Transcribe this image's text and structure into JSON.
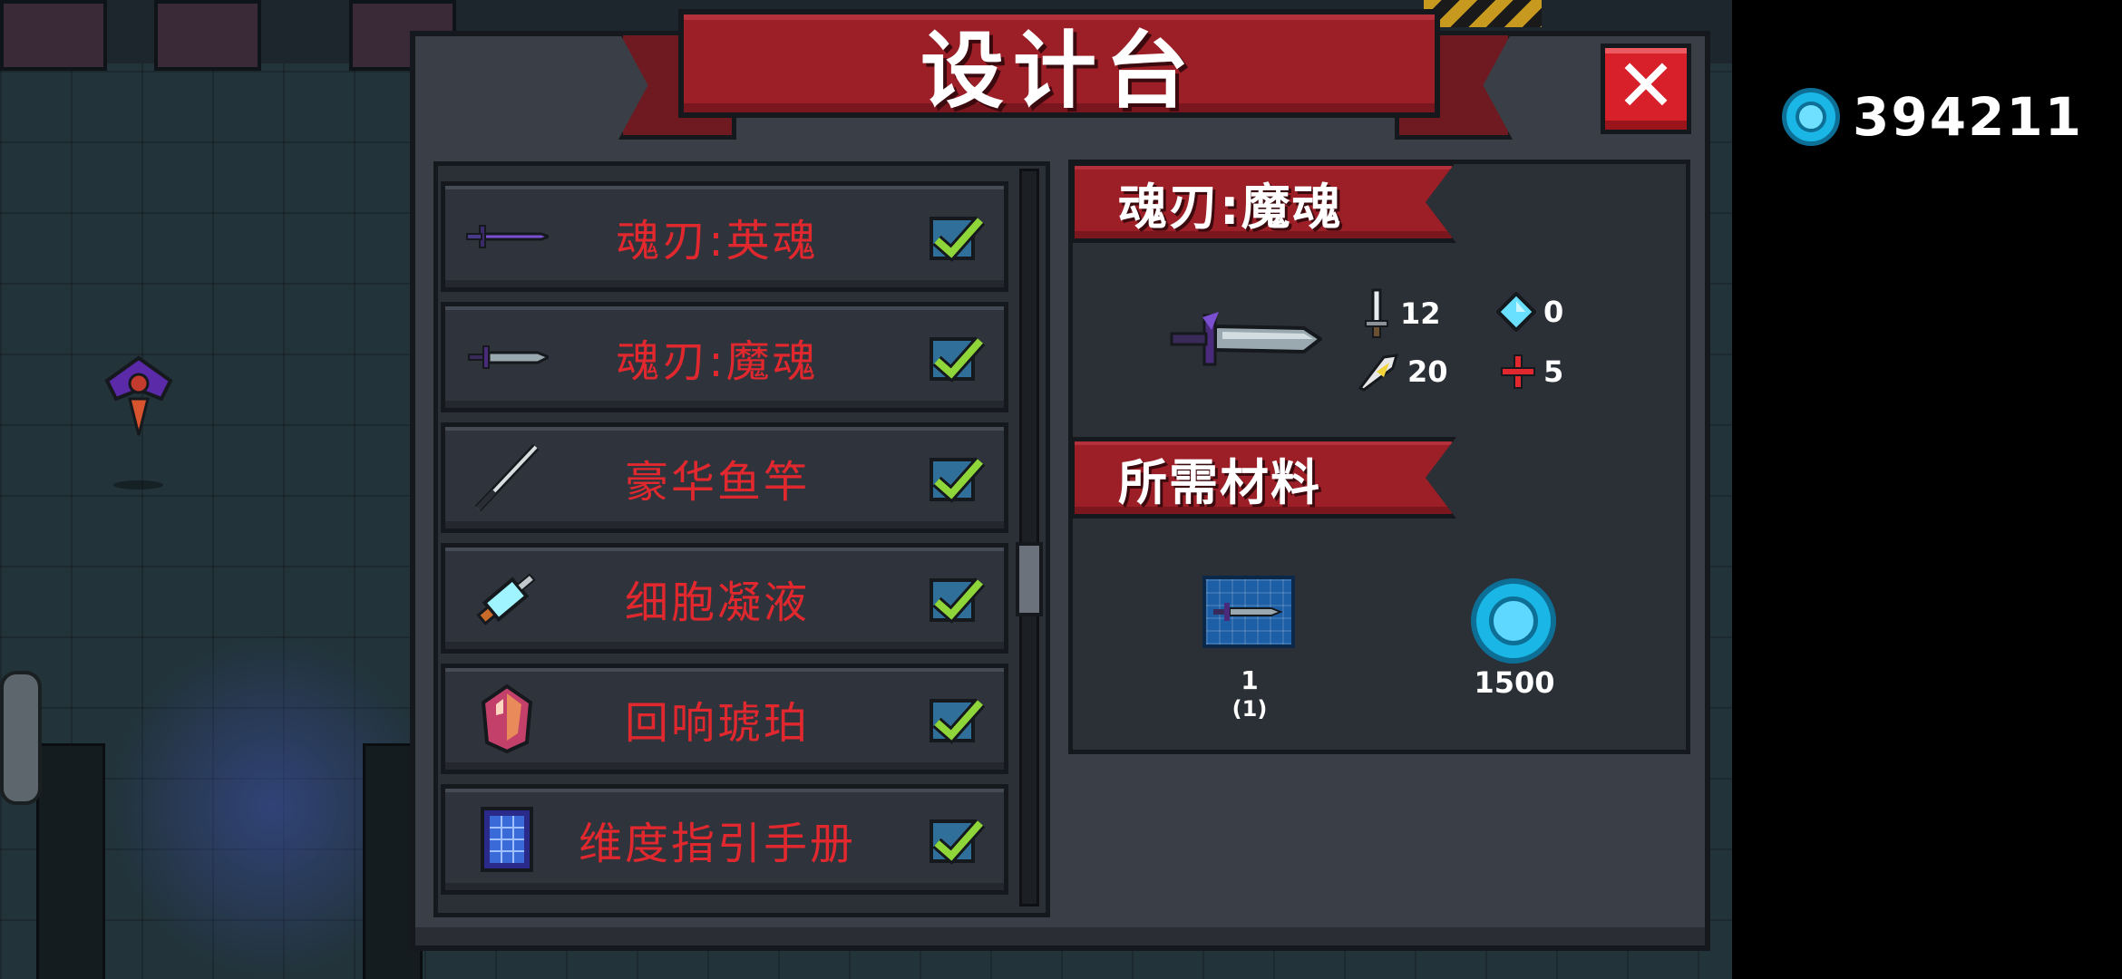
{
  "window": {
    "title": "设计台",
    "close_label": "✕"
  },
  "currency": {
    "icon": "blue-gem-icon",
    "amount": "394211"
  },
  "recipes": [
    {
      "name": "魂刃:英魂",
      "icon": "purple-sword-icon",
      "checked": true
    },
    {
      "name": "魂刃:魔魂",
      "icon": "dark-blade-icon",
      "checked": true
    },
    {
      "name": "豪华鱼竿",
      "icon": "fishing-rod-icon",
      "checked": true
    },
    {
      "name": "细胞凝液",
      "icon": "syringe-icon",
      "checked": true
    },
    {
      "name": "回响琥珀",
      "icon": "amber-gem-icon",
      "checked": true
    },
    {
      "name": "维度指引手册",
      "icon": "blue-manual-icon",
      "checked": true
    }
  ],
  "detail": {
    "item_name": "魂刃:魔魂",
    "stats": {
      "damage": "12",
      "energy": "0",
      "crit": "20",
      "accuracy": "5"
    },
    "materials_heading": "所需材料",
    "materials": [
      {
        "icon": "blueprint-icon",
        "amount": "1",
        "owned": "(1)"
      },
      {
        "icon": "gem-coin-icon",
        "amount": "1500"
      }
    ]
  },
  "colors": {
    "ribbon_red": "#9c1e26",
    "item_name_red": "#e0282e",
    "panel_bg": "#3a3f47",
    "check_green": "#8fd63a",
    "gem_blue": "#1ab7e6"
  }
}
